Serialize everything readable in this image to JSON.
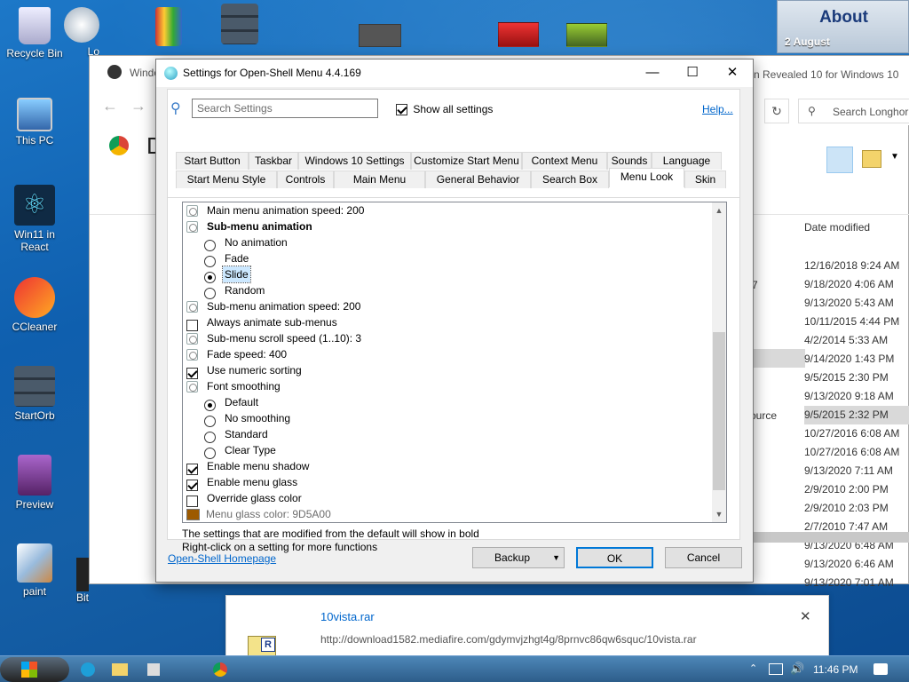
{
  "desktop": {
    "icons": [
      {
        "label": "Recycle Bin"
      },
      {
        "label": "This PC"
      },
      {
        "label": "Win11 in React"
      },
      {
        "label": "CCleaner"
      },
      {
        "label": "StartOrb"
      },
      {
        "label": "Preview"
      },
      {
        "label": "paint"
      }
    ],
    "partial_labels": [
      "Lo",
      "S",
      "Bit",
      "C"
    ]
  },
  "about_widget": {
    "title": "About",
    "date": "2 August"
  },
  "explorer": {
    "title_partial": "Windo",
    "title_right": "n Revealed 10 for Windows 10",
    "search_placeholder": "Search Longhorn",
    "partial_text_1": "7",
    "partial_text_2": "ource",
    "date_header": "Date modified",
    "dates": [
      "12/16/2018 9:24 AM",
      "9/18/2020 4:06 AM",
      "9/13/2020 5:43 AM",
      "10/11/2015 4:44 PM",
      "4/2/2014 5:33 AM",
      "9/14/2020 1:43 PM",
      "9/5/2015 2:30 PM",
      "9/13/2020 9:18 AM",
      "9/5/2015 2:32 PM",
      "10/27/2016 6:08 AM",
      "10/27/2016 6:08 AM",
      "9/13/2020 7:11 AM",
      "2/9/2010 2:00 PM",
      "2/9/2010 2:03 PM",
      "2/7/2010 7:47 AM",
      "9/13/2020 6:48 AM",
      "9/13/2020 6:46 AM",
      "9/13/2020 7:01 AM"
    ],
    "selected_index": 8
  },
  "dialog": {
    "title": "Settings for Open-Shell Menu 4.4.169",
    "search_placeholder": "Search Settings",
    "show_all_label": "Show all settings",
    "show_all_checked": true,
    "help_label": "Help...",
    "tabs_row1": [
      "Start Button",
      "Taskbar",
      "Windows 10 Settings",
      "Customize Start Menu",
      "Context Menu",
      "Sounds",
      "Language"
    ],
    "tabs_row2": [
      "Start Menu Style",
      "Controls",
      "Main Menu",
      "General Behavior",
      "Search Box",
      "Menu Look",
      "Skin"
    ],
    "active_tab": "Menu Look",
    "settings": [
      {
        "kind": "gear",
        "label": "Main menu animation speed: 200"
      },
      {
        "kind": "gear",
        "label": "Sub-menu animation",
        "bold": true
      },
      {
        "kind": "radio",
        "label": "No animation",
        "checked": false
      },
      {
        "kind": "radio",
        "label": "Fade",
        "checked": false
      },
      {
        "kind": "radio",
        "label": "Slide",
        "checked": true,
        "highlight": true
      },
      {
        "kind": "radio",
        "label": "Random",
        "checked": false
      },
      {
        "kind": "gear",
        "label": "Sub-menu animation speed: 200"
      },
      {
        "kind": "check",
        "label": "Always animate sub-menus",
        "checked": false
      },
      {
        "kind": "gear",
        "label": "Sub-menu scroll speed (1..10): 3"
      },
      {
        "kind": "gear",
        "label": "Fade speed: 400"
      },
      {
        "kind": "check",
        "label": "Use numeric sorting",
        "checked": true
      },
      {
        "kind": "gear",
        "label": "Font smoothing"
      },
      {
        "kind": "radio",
        "label": "Default",
        "checked": true
      },
      {
        "kind": "radio",
        "label": "No smoothing",
        "checked": false
      },
      {
        "kind": "radio",
        "label": "Standard",
        "checked": false
      },
      {
        "kind": "radio",
        "label": "Clear Type",
        "checked": false
      },
      {
        "kind": "check",
        "label": "Enable menu shadow",
        "checked": true
      },
      {
        "kind": "check",
        "label": "Enable menu glass",
        "checked": true
      },
      {
        "kind": "check",
        "label": "Override glass color",
        "checked": false
      },
      {
        "kind": "color",
        "label": "Menu glass color: 9D5A00",
        "disabled": true,
        "color": "#9D5A00"
      }
    ],
    "info_line1": "The settings that are modified from the default will show in bold",
    "info_line2": "Right-click on a setting for more functions",
    "homepage_link": "Open-Shell Homepage",
    "backup_label": "Backup",
    "ok_label": "OK",
    "cancel_label": "Cancel"
  },
  "download": {
    "filename": "10vista.rar",
    "url": "http://download1582.mediafire.com/gdymvjzhgt4g/8prnvc86qw6squc/10vista.rar"
  },
  "taskbar": {
    "time": "11:46 PM"
  },
  "colors": {
    "accent": "#0078d7",
    "link": "#0066cc",
    "glass": "#9D5A00"
  }
}
